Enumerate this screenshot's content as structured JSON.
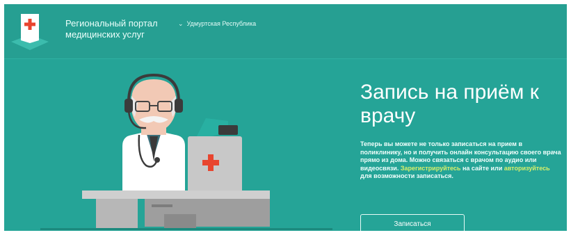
{
  "header": {
    "portal_title": "Региональный портал медицинских услуг",
    "region_label": "Удмуртская Республика"
  },
  "hero": {
    "title": "Запись на приём к врачу",
    "text_part1": "Теперь вы можете не только записаться на прием в поликлинику, но и получить онлайн консультацию своего врача прямо из дома. Можно связаться с врачом по аудио или видеосвязи. ",
    "register_link": "Зарегистрируйтесь",
    "text_part2": " на сайте или ",
    "authorize_link": "авторизуйтесь",
    "text_part3": " для возможности записаться.",
    "cta_label": "Записаться"
  },
  "icons": {
    "logo": "medical-cross-logo-icon",
    "region_chevron": "chevron-down-icon",
    "illustration": "doctor-at-desk-illustration"
  },
  "colors": {
    "background": "#25a497",
    "header": "#269f92",
    "highlight": "#d8f06a",
    "cross": "#e8452f"
  }
}
